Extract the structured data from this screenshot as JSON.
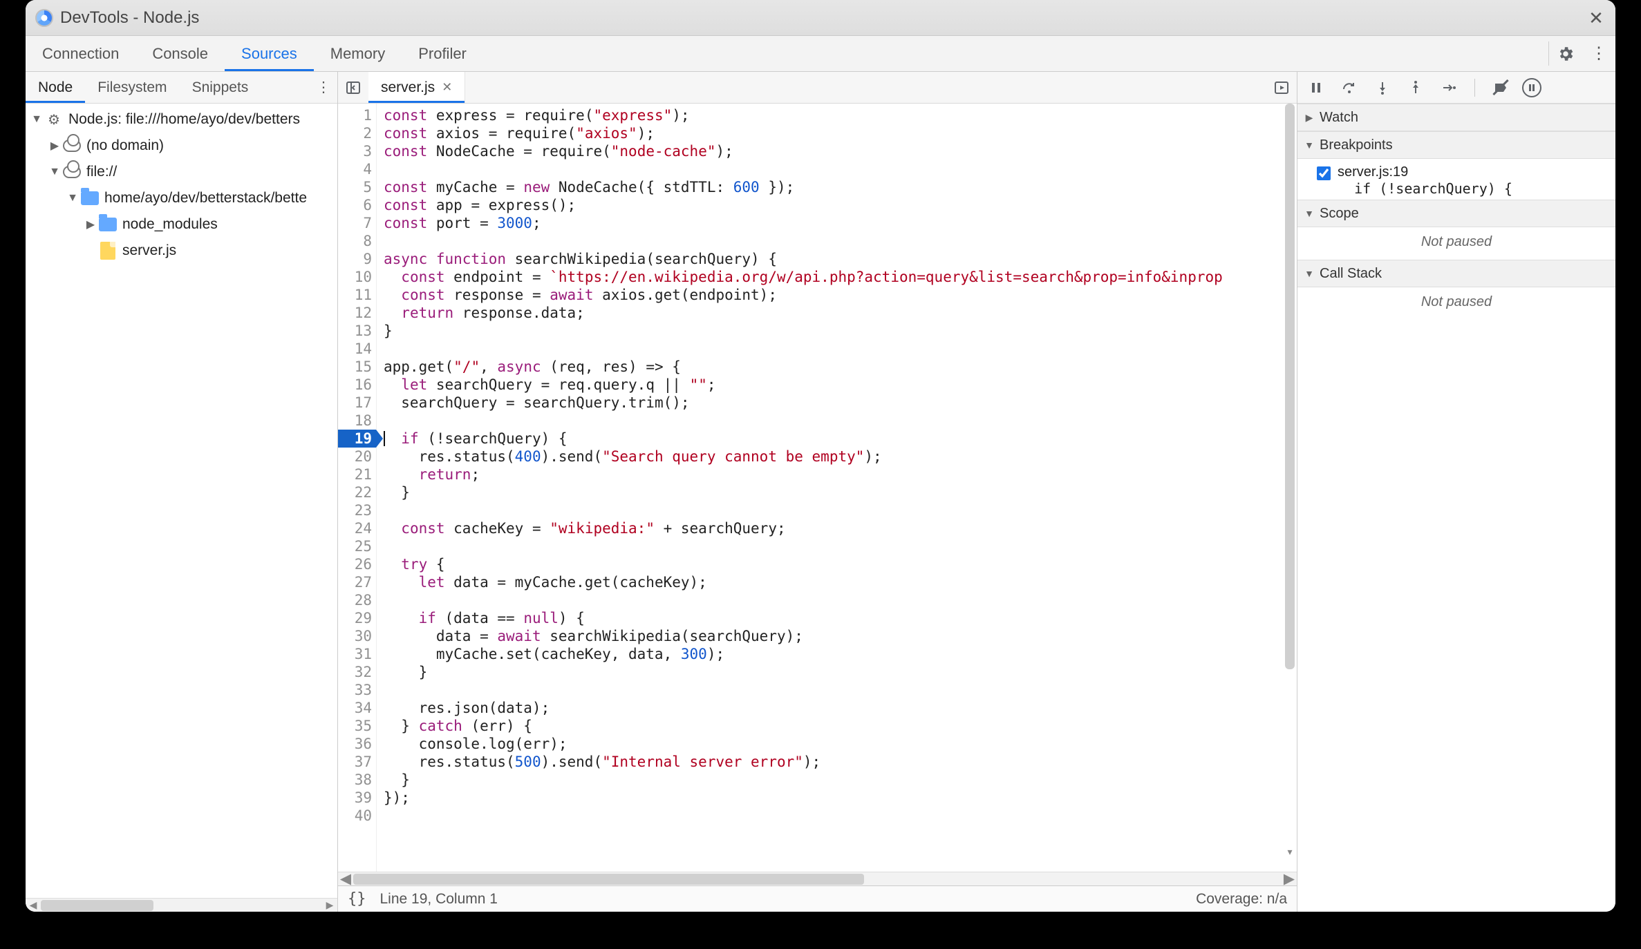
{
  "window": {
    "title": "DevTools - Node.js"
  },
  "top_tabs": {
    "items": [
      "Connection",
      "Console",
      "Sources",
      "Memory",
      "Profiler"
    ],
    "active_index": 2,
    "gear_icon": "gear",
    "more_icon": "more"
  },
  "nav": {
    "subtabs": {
      "items": [
        "Node",
        "Filesystem",
        "Snippets"
      ],
      "active_index": 0
    },
    "tree": [
      {
        "depth": 0,
        "twisty": "down",
        "icon": "gear",
        "label": "Node.js: file:///home/ayo/dev/betters"
      },
      {
        "depth": 1,
        "twisty": "right",
        "icon": "cloud",
        "label": "(no domain)"
      },
      {
        "depth": 1,
        "twisty": "down",
        "icon": "cloud",
        "label": "file://"
      },
      {
        "depth": 2,
        "twisty": "down",
        "icon": "folder",
        "label": "home/ayo/dev/betterstack/bette"
      },
      {
        "depth": 3,
        "twisty": "right",
        "icon": "folder",
        "label": "node_modules"
      },
      {
        "depth": 3,
        "twisty": "",
        "icon": "file",
        "label": "server.js"
      }
    ]
  },
  "editor": {
    "open_file": "server.js",
    "breakpoint_lines": [
      19
    ],
    "cursor": {
      "line": 19,
      "col": 1
    },
    "lines": [
      {
        "n": 1,
        "segs": [
          [
            "kw",
            "const"
          ],
          [
            "op",
            " express "
          ],
          [
            "op",
            "= "
          ],
          [
            "fn",
            "require"
          ],
          [
            "op",
            "("
          ],
          [
            "str",
            "\"express\""
          ],
          [
            "op",
            ");"
          ]
        ]
      },
      {
        "n": 2,
        "segs": [
          [
            "kw",
            "const"
          ],
          [
            "op",
            " axios "
          ],
          [
            "op",
            "= "
          ],
          [
            "fn",
            "require"
          ],
          [
            "op",
            "("
          ],
          [
            "str",
            "\"axios\""
          ],
          [
            "op",
            ");"
          ]
        ]
      },
      {
        "n": 3,
        "segs": [
          [
            "kw",
            "const"
          ],
          [
            "op",
            " NodeCache "
          ],
          [
            "op",
            "= "
          ],
          [
            "fn",
            "require"
          ],
          [
            "op",
            "("
          ],
          [
            "str",
            "\"node-cache\""
          ],
          [
            "op",
            ");"
          ]
        ]
      },
      {
        "n": 4,
        "segs": []
      },
      {
        "n": 5,
        "segs": [
          [
            "kw",
            "const"
          ],
          [
            "op",
            " myCache "
          ],
          [
            "op",
            "= "
          ],
          [
            "kw",
            "new"
          ],
          [
            "op",
            " NodeCache({ stdTTL: "
          ],
          [
            "nm",
            "600"
          ],
          [
            "op",
            " });"
          ]
        ]
      },
      {
        "n": 6,
        "segs": [
          [
            "kw",
            "const"
          ],
          [
            "op",
            " app "
          ],
          [
            "op",
            "= express();"
          ]
        ]
      },
      {
        "n": 7,
        "segs": [
          [
            "kw",
            "const"
          ],
          [
            "op",
            " port "
          ],
          [
            "op",
            "= "
          ],
          [
            "nm",
            "3000"
          ],
          [
            "op",
            ";"
          ]
        ]
      },
      {
        "n": 8,
        "segs": []
      },
      {
        "n": 9,
        "segs": [
          [
            "kw",
            "async function"
          ],
          [
            "op",
            " "
          ],
          [
            "fn",
            "searchWikipedia"
          ],
          [
            "op",
            "(searchQuery) {"
          ]
        ]
      },
      {
        "n": 10,
        "segs": [
          [
            "op",
            "  "
          ],
          [
            "kw",
            "const"
          ],
          [
            "op",
            " endpoint "
          ],
          [
            "op",
            "= "
          ],
          [
            "str",
            "`https://en.wikipedia.org/w/api.php?action=query&list=search&prop=info&inprop"
          ]
        ]
      },
      {
        "n": 11,
        "segs": [
          [
            "op",
            "  "
          ],
          [
            "kw",
            "const"
          ],
          [
            "op",
            " response "
          ],
          [
            "op",
            "= "
          ],
          [
            "kw",
            "await"
          ],
          [
            "op",
            " axios.get(endpoint);"
          ]
        ]
      },
      {
        "n": 12,
        "segs": [
          [
            "op",
            "  "
          ],
          [
            "kw",
            "return"
          ],
          [
            "op",
            " response.data;"
          ]
        ]
      },
      {
        "n": 13,
        "segs": [
          [
            "op",
            "}"
          ]
        ]
      },
      {
        "n": 14,
        "segs": []
      },
      {
        "n": 15,
        "segs": [
          [
            "op",
            "app.get("
          ],
          [
            "str",
            "\"/\""
          ],
          [
            "op",
            ", "
          ],
          [
            "kw",
            "async"
          ],
          [
            "op",
            " (req, res) "
          ],
          [
            "op",
            "=>"
          ],
          [
            "op",
            " {"
          ]
        ]
      },
      {
        "n": 16,
        "segs": [
          [
            "op",
            "  "
          ],
          [
            "kw",
            "let"
          ],
          [
            "op",
            " searchQuery "
          ],
          [
            "op",
            "= req.query.q "
          ],
          [
            "op",
            "||"
          ],
          [
            "op",
            " "
          ],
          [
            "str",
            "\"\""
          ],
          [
            "op",
            ";"
          ]
        ]
      },
      {
        "n": 17,
        "segs": [
          [
            "op",
            "  searchQuery "
          ],
          [
            "op",
            "= searchQuery.trim();"
          ]
        ]
      },
      {
        "n": 18,
        "segs": []
      },
      {
        "n": 19,
        "segs": [
          [
            "op",
            "  "
          ],
          [
            "kw",
            "if"
          ],
          [
            "op",
            " (!searchQuery) {"
          ]
        ]
      },
      {
        "n": 20,
        "segs": [
          [
            "op",
            "    res.status("
          ],
          [
            "nm",
            "400"
          ],
          [
            "op",
            ").send("
          ],
          [
            "str",
            "\"Search query cannot be empty\""
          ],
          [
            "op",
            ");"
          ]
        ]
      },
      {
        "n": 21,
        "segs": [
          [
            "op",
            "    "
          ],
          [
            "kw",
            "return"
          ],
          [
            "op",
            ";"
          ]
        ]
      },
      {
        "n": 22,
        "segs": [
          [
            "op",
            "  }"
          ]
        ]
      },
      {
        "n": 23,
        "segs": []
      },
      {
        "n": 24,
        "segs": [
          [
            "op",
            "  "
          ],
          [
            "kw",
            "const"
          ],
          [
            "op",
            " cacheKey "
          ],
          [
            "op",
            "= "
          ],
          [
            "str",
            "\"wikipedia:\""
          ],
          [
            "op",
            " + searchQuery;"
          ]
        ]
      },
      {
        "n": 25,
        "segs": []
      },
      {
        "n": 26,
        "segs": [
          [
            "op",
            "  "
          ],
          [
            "kw",
            "try"
          ],
          [
            "op",
            " {"
          ]
        ]
      },
      {
        "n": 27,
        "segs": [
          [
            "op",
            "    "
          ],
          [
            "kw",
            "let"
          ],
          [
            "op",
            " data "
          ],
          [
            "op",
            "= myCache.get(cacheKey);"
          ]
        ]
      },
      {
        "n": 28,
        "segs": []
      },
      {
        "n": 29,
        "segs": [
          [
            "op",
            "    "
          ],
          [
            "kw",
            "if"
          ],
          [
            "op",
            " (data "
          ],
          [
            "op",
            "=="
          ],
          [
            "op",
            " "
          ],
          [
            "kw",
            "null"
          ],
          [
            "op",
            ") {"
          ]
        ]
      },
      {
        "n": 30,
        "segs": [
          [
            "op",
            "      data "
          ],
          [
            "op",
            "= "
          ],
          [
            "kw",
            "await"
          ],
          [
            "op",
            " searchWikipedia(searchQuery);"
          ]
        ]
      },
      {
        "n": 31,
        "segs": [
          [
            "op",
            "      myCache.set(cacheKey, data, "
          ],
          [
            "nm",
            "300"
          ],
          [
            "op",
            ");"
          ]
        ]
      },
      {
        "n": 32,
        "segs": [
          [
            "op",
            "    }"
          ]
        ]
      },
      {
        "n": 33,
        "segs": []
      },
      {
        "n": 34,
        "segs": [
          [
            "op",
            "    res.json(data);"
          ]
        ]
      },
      {
        "n": 35,
        "segs": [
          [
            "op",
            "  } "
          ],
          [
            "kw",
            "catch"
          ],
          [
            "op",
            " (err) {"
          ]
        ]
      },
      {
        "n": 36,
        "segs": [
          [
            "op",
            "    console.log(err);"
          ]
        ]
      },
      {
        "n": 37,
        "segs": [
          [
            "op",
            "    res.status("
          ],
          [
            "nm",
            "500"
          ],
          [
            "op",
            ").send("
          ],
          [
            "str",
            "\"Internal server error\""
          ],
          [
            "op",
            ");"
          ]
        ]
      },
      {
        "n": 38,
        "segs": [
          [
            "op",
            "  }"
          ]
        ]
      },
      {
        "n": 39,
        "segs": [
          [
            "op",
            "});"
          ]
        ]
      },
      {
        "n": 40,
        "segs": []
      }
    ],
    "status": {
      "pretty": "{}",
      "pos": "Line 19, Column 1",
      "coverage": "Coverage: n/a"
    }
  },
  "debugger": {
    "toolbar": [
      "pause",
      "step-over",
      "step-into",
      "step-out",
      "step",
      "deactivate-breakpoints",
      "pause-on-exceptions"
    ],
    "sections": {
      "watch": {
        "label": "Watch",
        "expanded": false
      },
      "breakpoints": {
        "label": "Breakpoints",
        "expanded": true,
        "items": [
          {
            "checked": true,
            "loc": "server.js:19",
            "code": "  if (!searchQuery) {"
          }
        ]
      },
      "scope": {
        "label": "Scope",
        "expanded": true,
        "body": "Not paused"
      },
      "callstack": {
        "label": "Call Stack",
        "expanded": true,
        "body": "Not paused"
      }
    }
  }
}
